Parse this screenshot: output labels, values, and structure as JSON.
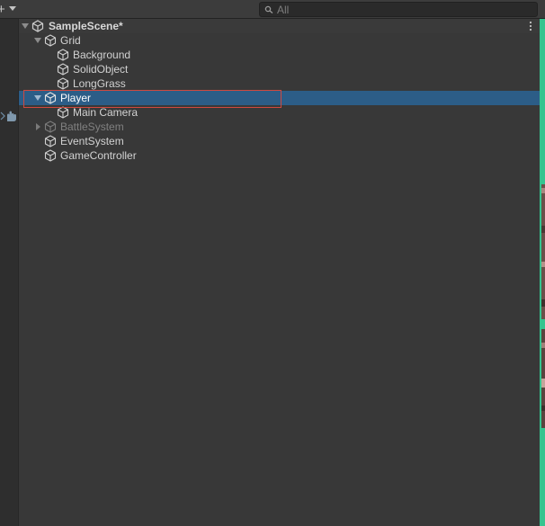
{
  "toolbar": {
    "add_icon": "plus-icon",
    "search": {
      "placeholder": "All",
      "value": ""
    }
  },
  "hierarchy": {
    "scene": {
      "label": "SampleScene*",
      "icon": "unity-logo-icon"
    },
    "items": [
      {
        "label": "Grid",
        "expanded": true,
        "icon": "gameobject-cube-icon"
      },
      {
        "label": "Background",
        "icon": "gameobject-cube-icon"
      },
      {
        "label": "SolidObject",
        "icon": "gameobject-cube-icon"
      },
      {
        "label": "LongGrass",
        "icon": "gameobject-cube-icon"
      },
      {
        "label": "Player",
        "expanded": true,
        "selected": true,
        "icon": "gameobject-cube-icon"
      },
      {
        "label": "Main Camera",
        "icon": "gameobject-cube-icon"
      },
      {
        "label": "BattleSystem",
        "expanded": false,
        "inactive": true,
        "icon": "gameobject-cube-icon"
      },
      {
        "label": "EventSystem",
        "icon": "gameobject-cube-icon"
      },
      {
        "label": "GameController",
        "icon": "gameobject-cube-icon"
      }
    ]
  },
  "colors": {
    "panel_bg": "#383838",
    "selection": "#2c5d87",
    "highlight_outline": "#d0493f",
    "scene_view_green": "#35c48f"
  }
}
